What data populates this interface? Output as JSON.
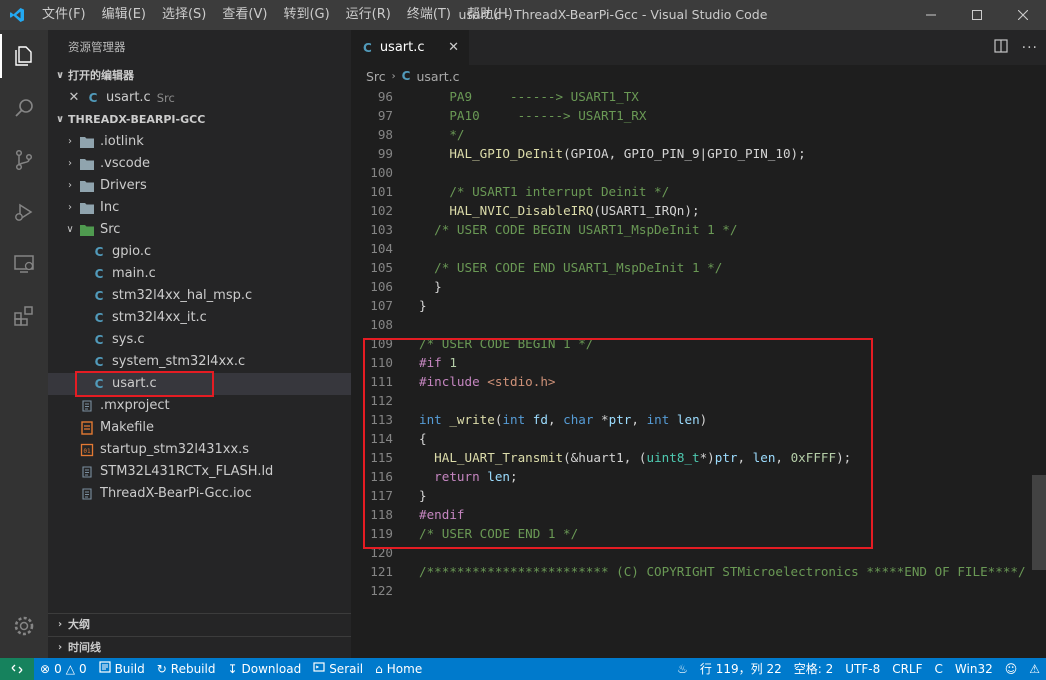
{
  "window": {
    "title": "usart.c - ThreadX-BearPi-Gcc - Visual Studio Code",
    "menus": [
      "文件(F)",
      "编辑(E)",
      "选择(S)",
      "查看(V)",
      "转到(G)",
      "运行(R)",
      "终端(T)",
      "帮助(H)"
    ]
  },
  "sidebar": {
    "title": "资源管理器",
    "open_editors_label": "打开的编辑器",
    "open_editor": {
      "name": "usart.c",
      "folder": "Src"
    },
    "project_label": "THREADX-BEARPI-GCC",
    "tree": [
      {
        "name": ".iotlink",
        "kind": "folder",
        "expanded": false
      },
      {
        "name": ".vscode",
        "kind": "folder",
        "expanded": false
      },
      {
        "name": "Drivers",
        "kind": "folder",
        "expanded": false
      },
      {
        "name": "Inc",
        "kind": "folder",
        "expanded": false
      },
      {
        "name": "Src",
        "kind": "folder",
        "expanded": true
      },
      {
        "name": "gpio.c",
        "kind": "c"
      },
      {
        "name": "main.c",
        "kind": "c"
      },
      {
        "name": "stm32l4xx_hal_msp.c",
        "kind": "c"
      },
      {
        "name": "stm32l4xx_it.c",
        "kind": "c"
      },
      {
        "name": "sys.c",
        "kind": "c"
      },
      {
        "name": "system_stm32l4xx.c",
        "kind": "c"
      },
      {
        "name": "usart.c",
        "kind": "c",
        "selected": true
      },
      {
        "name": ".mxproject",
        "kind": "file"
      },
      {
        "name": "Makefile",
        "kind": "makefile"
      },
      {
        "name": "startup_stm32l431xx.s",
        "kind": "asm"
      },
      {
        "name": "STM32L431RCTx_FLASH.ld",
        "kind": "file"
      },
      {
        "name": "ThreadX-BearPi-Gcc.ioc",
        "kind": "file"
      }
    ],
    "outline_label": "大纲",
    "timeline_label": "时间线"
  },
  "editor": {
    "tab_label": "usart.c",
    "breadcrumb": [
      "Src",
      "usart.c"
    ],
    "first_line": 96,
    "lines": [
      "    PA9     ------> USART1_TX",
      "    PA10     ------> USART1_RX",
      "    */",
      "    HAL_GPIO_DeInit(GPIOA, GPIO_PIN_9|GPIO_PIN_10);",
      "",
      "    /* USART1 interrupt Deinit */",
      "    HAL_NVIC_DisableIRQ(USART1_IRQn);",
      "  /* USER CODE BEGIN USART1_MspDeInit 1 */",
      "",
      "  /* USER CODE END USART1_MspDeInit 1 */",
      "  }",
      "}",
      "",
      "/* USER CODE BEGIN 1 */",
      "#if 1",
      "#include <stdio.h>",
      "",
      "int _write(int fd, char *ptr, int len)",
      "{",
      "  HAL_UART_Transmit(&huart1, (uint8_t*)ptr, len, 0xFFFF);",
      "  return len;",
      "}",
      "#endif",
      "/* USER CODE END 1 */",
      "",
      "/************************ (C) COPYRIGHT STMicroelectronics *****END OF FILE****/",
      ""
    ]
  },
  "statusbar": {
    "errors": "0",
    "warnings": "0",
    "build": "Build",
    "rebuild": "Rebuild",
    "download": "Download",
    "serial": "Serail",
    "home": "Home",
    "position": "行 119，列 22",
    "spaces": "空格: 2",
    "encoding": "UTF-8",
    "eol": "CRLF",
    "language": "C",
    "platform": "Win32"
  },
  "colors": {
    "accent": "#007acc",
    "highlight_box": "#e51c23"
  }
}
